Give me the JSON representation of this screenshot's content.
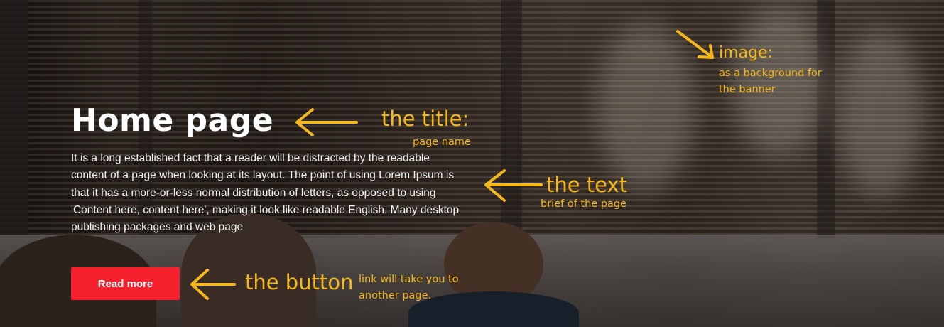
{
  "banner": {
    "title": "Home page",
    "text": "It is a long established fact that a reader will be distracted by the readable content of a page when looking at its layout. The point of using Lorem Ipsum is that it has a more-or-less normal distribution of letters, as opposed to using 'Content here, content here', making it look like readable English. Many desktop publishing packages and web page",
    "button_label": "Read more",
    "button_color": "#f5222d",
    "background_image": "photo-of-people-sitting-outside-building"
  },
  "annotations": {
    "image_label": "image:",
    "image_desc_line1": "as a background for",
    "image_desc_line2": "the banner",
    "title_label": "the title:",
    "title_desc": "page name",
    "text_label": "the text",
    "text_desc": "brief of the page",
    "button_label": "the button",
    "button_desc_line1": "link will take you to",
    "button_desc_line2": "another page.",
    "color": "#f5b81c"
  }
}
